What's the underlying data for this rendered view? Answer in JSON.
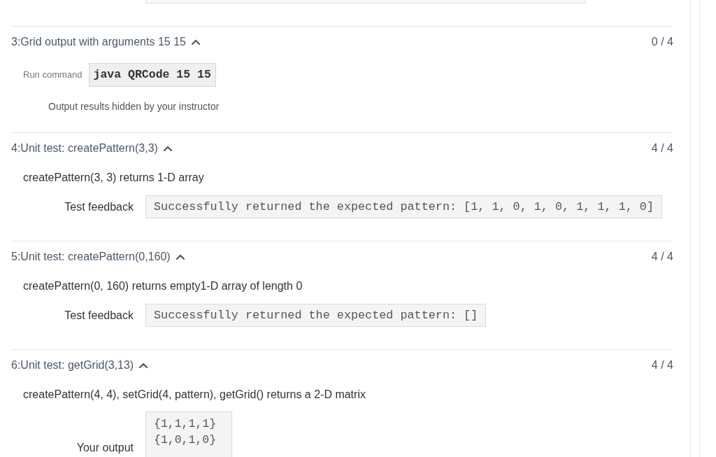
{
  "tests": [
    {
      "kind": "run",
      "heading": "3:Grid output with arguments 15 15",
      "expanded": true,
      "score": "0 / 4",
      "command_label": "Run command",
      "command": "java QRCode 15 15",
      "note": "Output results hidden by your instructor"
    },
    {
      "kind": "feedback",
      "heading": "4:Unit test: createPattern(3,3)",
      "expanded": true,
      "score": "4 / 4",
      "description": "createPattern(3, 3) returns 1-D array",
      "feedback_label": "Test feedback",
      "feedback": "Successfully returned the expected pattern: [1, 1, 0, 1, 0, 1, 1, 1, 0]"
    },
    {
      "kind": "feedback",
      "heading": "5:Unit test: createPattern(0,160)",
      "expanded": true,
      "score": "4 / 4",
      "description": "createPattern(0, 160) returns empty1-D array of length 0",
      "feedback_label": "Test feedback",
      "feedback": "Successfully returned the expected pattern: []"
    },
    {
      "kind": "output",
      "heading": "6:Unit test: getGrid(3,13)",
      "expanded": true,
      "score": "4 / 4",
      "description": "createPattern(4, 4), setGrid(4, pattern), getGrid() returns a 2-D matrix",
      "output_label": "Your output",
      "output_lines": [
        "{1,1,1,1}",
        "{1,0,1,0}"
      ]
    }
  ]
}
